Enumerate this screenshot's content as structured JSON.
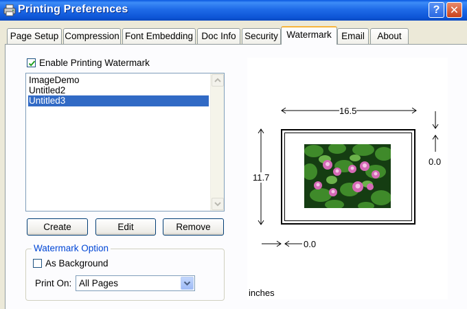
{
  "window": {
    "title": "Printing Preferences",
    "help_label": "?",
    "close_label": "✕",
    "icon": "printer-icon"
  },
  "tabs": [
    {
      "label": "Page Setup",
      "active": false
    },
    {
      "label": "Compression",
      "active": false
    },
    {
      "label": "Font Embedding",
      "active": false
    },
    {
      "label": "Doc Info",
      "active": false
    },
    {
      "label": "Security",
      "active": false
    },
    {
      "label": "Watermark",
      "active": true
    },
    {
      "label": "Email",
      "active": false
    },
    {
      "label": "About",
      "active": false
    }
  ],
  "watermark": {
    "enable_label": "Enable Printing Watermark",
    "enable_checked": true,
    "list_items": [
      {
        "label": "ImageDemo",
        "selected": false
      },
      {
        "label": "Untitled2",
        "selected": false
      },
      {
        "label": "Untitled3",
        "selected": true
      }
    ],
    "buttons": {
      "create": "Create",
      "edit": "Edit",
      "remove": "Remove"
    },
    "option_group": {
      "legend": "Watermark Option",
      "as_background_label": "As Background",
      "as_background_checked": false,
      "print_on_label": "Print On:",
      "print_on_value": "All Pages"
    }
  },
  "preview": {
    "width": "16.5",
    "height": "11.7",
    "top_offset": "0.0",
    "left_offset": "0.0",
    "units": "inches",
    "image": "water-lily-image"
  },
  "colors": {
    "titlebar": "#0d55d6",
    "selection": "#316ac5",
    "active_tab_accent": "#f7b43a",
    "group_legend": "#0046d5"
  }
}
